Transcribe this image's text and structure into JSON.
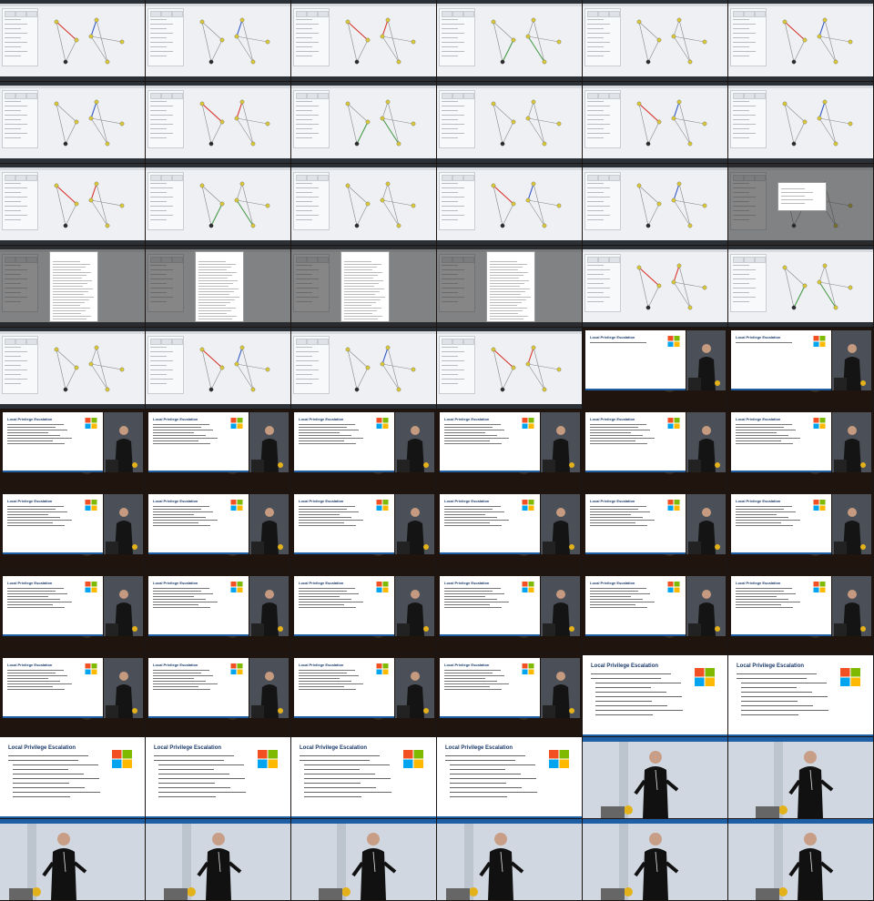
{
  "layout": "contact-sheet",
  "rows": [
    [
      "app",
      "app",
      "app",
      "app",
      "app",
      "app"
    ],
    [
      "app",
      "app",
      "app",
      "app",
      "app",
      "app"
    ],
    [
      "app",
      "app",
      "app",
      "app",
      "app",
      "app-dialog"
    ],
    [
      "app-doc",
      "app-doc",
      "app-doc",
      "app-doc",
      "app",
      "app"
    ],
    [
      "app",
      "app",
      "app",
      "app",
      "slide-intro",
      "slide-intro"
    ],
    [
      "slide",
      "slide",
      "slide",
      "slide",
      "slide",
      "slide"
    ],
    [
      "slide",
      "slide",
      "slide",
      "slide",
      "slide",
      "slide"
    ],
    [
      "slide",
      "slide",
      "slide",
      "slide",
      "slide",
      "slide"
    ],
    [
      "slide",
      "slide",
      "slide",
      "slide",
      "bigslide",
      "bigslide"
    ],
    [
      "bigslide",
      "bigslide",
      "bigslide",
      "bigslide",
      "stage",
      "stage"
    ],
    [
      "stage",
      "stage",
      "stage",
      "stage",
      "stage",
      "stage"
    ]
  ],
  "slide": {
    "title": "Local Privilege Escalation",
    "lead": "Gain elevated access on a system from low-privileged user to admin",
    "sub_heading": "Common Methods",
    "bullets": [
      "Unsecured software through missing updates (OS, 3rd party services, ...)",
      "Stored data/text credentials (documents, configuration files, scripts, ...)",
      "Local users / auto-logon users (DefDomain via GPOs)",
      "Write permissions on logon scripts, accessed services, service binaries, application files",
      "Modifiable services / tasks",
      "Users being able to install own print drivers",
      "Users being able to write to folders which are included in the PATH variable"
    ]
  },
  "colors": {
    "edge_red": "#d9322a",
    "edge_blue": "#2f57c8",
    "edge_green": "#4a9a4a",
    "node_yellow": "#d7c53a",
    "node_dark": "#2b2b2b",
    "win_red": "#f25022",
    "win_green": "#7fba00",
    "win_blue": "#00a4ef",
    "win_yellow": "#ffb900",
    "slide_accent": "#1f5fa5"
  },
  "icons": [
    "windows-logo-icon"
  ]
}
